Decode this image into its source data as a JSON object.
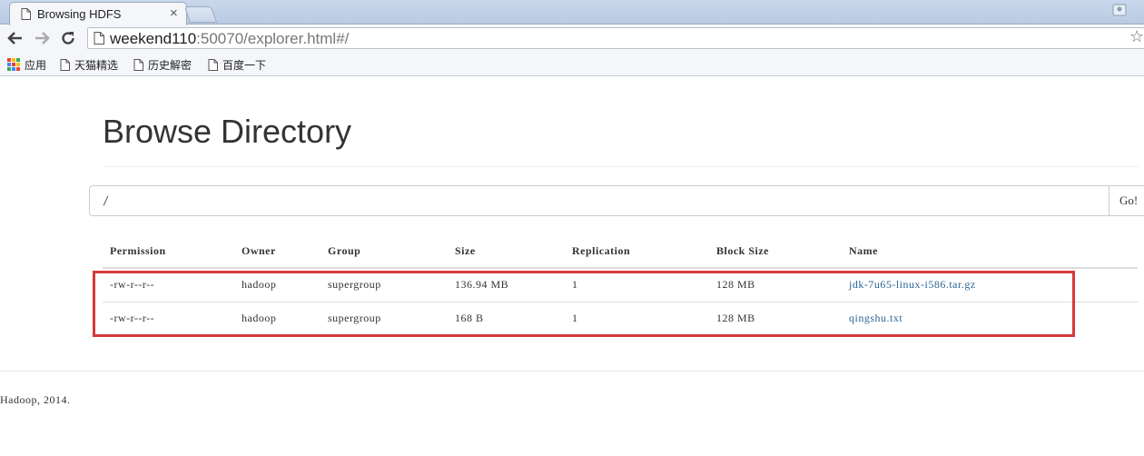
{
  "browser": {
    "tab_title": "Browsing HDFS",
    "tab_close": "×",
    "url_host": "weekend110",
    "url_rest": ":50070/explorer.html#/",
    "star": "☆",
    "bookmarks": [
      {
        "label": "应用",
        "icon": "apps-icon"
      },
      {
        "label": "天猫精选",
        "icon": "page-icon"
      },
      {
        "label": "历史解密",
        "icon": "page-icon"
      },
      {
        "label": "百度一下",
        "icon": "page-icon"
      }
    ]
  },
  "page": {
    "title": "Browse Directory",
    "path_value": "/",
    "go_label": "Go!"
  },
  "table": {
    "headers": [
      "Permission",
      "Owner",
      "Group",
      "Size",
      "Replication",
      "Block Size",
      "Name"
    ],
    "rows": [
      {
        "permission": "-rw-r--r--",
        "owner": "hadoop",
        "group": "supergroup",
        "size": "136.94 MB",
        "replication": "1",
        "block_size": "128 MB",
        "name": "jdk-7u65-linux-i586.tar.gz"
      },
      {
        "permission": "-rw-r--r--",
        "owner": "hadoop",
        "group": "supergroup",
        "size": "168 B",
        "replication": "1",
        "block_size": "128 MB",
        "name": "qingshu.txt"
      }
    ]
  },
  "footer": {
    "text": "Hadoop, 2014."
  },
  "colors": {
    "link": "#2a6496",
    "highlight": "#d9383a"
  }
}
